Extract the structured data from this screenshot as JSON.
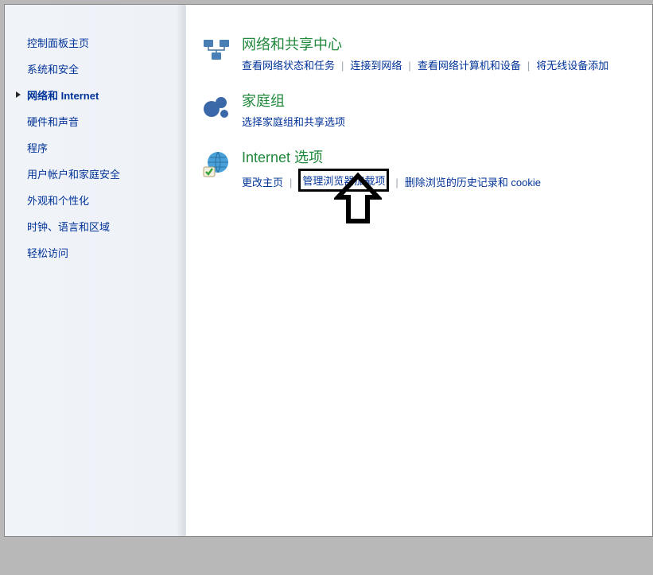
{
  "sidebar": {
    "items": [
      {
        "label": "控制面板主页",
        "active": false
      },
      {
        "label": "系统和安全",
        "active": false
      },
      {
        "label": "网络和 Internet",
        "active": true
      },
      {
        "label": "硬件和声音",
        "active": false
      },
      {
        "label": "程序",
        "active": false
      },
      {
        "label": "用户帐户和家庭安全",
        "active": false
      },
      {
        "label": "外观和个性化",
        "active": false
      },
      {
        "label": "时钟、语言和区域",
        "active": false
      },
      {
        "label": "轻松访问",
        "active": false
      }
    ]
  },
  "categories": [
    {
      "title": "网络和共享中心",
      "icon": "network-icon",
      "links": [
        "查看网络状态和任务",
        "连接到网络",
        "查看网络计算机和设备",
        "将无线设备添加"
      ]
    },
    {
      "title": "家庭组",
      "icon": "homegroup-icon",
      "links": [
        "选择家庭组和共享选项"
      ]
    },
    {
      "title": "Internet 选项",
      "icon": "globe-icon",
      "links": [
        "更改主页",
        "管理浏览器加载项",
        "删除浏览的历史记录和 cookie"
      ],
      "highlight_index": 1
    }
  ]
}
